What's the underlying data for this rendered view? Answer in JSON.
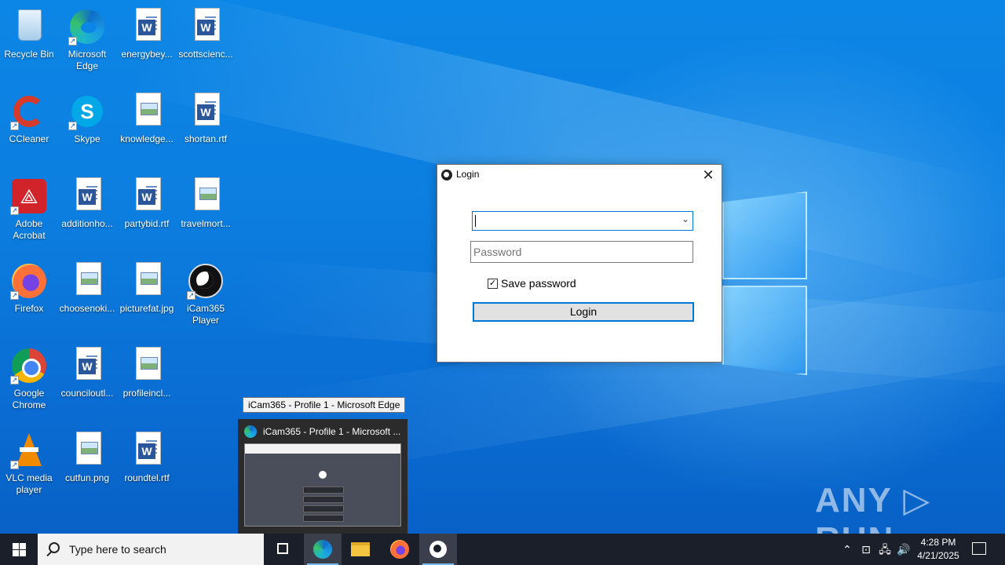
{
  "desktop": {
    "icons": [
      {
        "label": "Recycle Bin"
      },
      {
        "label": "Microsoft Edge"
      },
      {
        "label": "energybey..."
      },
      {
        "label": "scottscienc..."
      },
      {
        "label": "CCleaner"
      },
      {
        "label": "Skype"
      },
      {
        "label": "knowledge..."
      },
      {
        "label": "shortan.rtf"
      },
      {
        "label": "Adobe Acrobat"
      },
      {
        "label": "additionho..."
      },
      {
        "label": "partybid.rtf"
      },
      {
        "label": "travelmort..."
      },
      {
        "label": "Firefox"
      },
      {
        "label": "choosenoki..."
      },
      {
        "label": "picturefat.jpg"
      },
      {
        "label": "iCam365 Player"
      },
      {
        "label": "Google Chrome"
      },
      {
        "label": "counciloutl..."
      },
      {
        "label": "profileincl..."
      },
      {
        "label": "VLC media player"
      },
      {
        "label": "cutfun.png"
      },
      {
        "label": "roundtel.rtf"
      }
    ]
  },
  "dialog": {
    "title": "Login",
    "close_glyph": "✕",
    "username_value": "",
    "password_placeholder": "Password",
    "save_password_label": "Save password",
    "save_password_checked": true,
    "login_button": "Login"
  },
  "tooltip": {
    "text": "iCam365 - Profile 1 - Microsoft Edge"
  },
  "thumbnail": {
    "title": "iCam365 - Profile 1 - Microsoft ..."
  },
  "watermark": {
    "text": "ANY ▷ RUN"
  },
  "taskbar": {
    "search_placeholder": "Type here to search",
    "time": "4:28 PM",
    "date": "4/21/2025",
    "tray_icons": [
      "chevron-up-icon",
      "meet-now-icon",
      "network-icon",
      "volume-icon"
    ]
  }
}
